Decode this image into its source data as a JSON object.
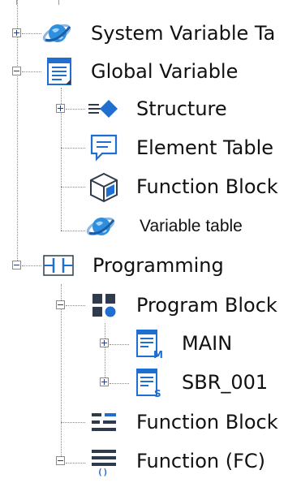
{
  "colors": {
    "line": "#8a8a8a",
    "icon_blue": "#1f6fd1",
    "icon_dark": "#2f3b4c",
    "globe_blue": "#2f8fdc",
    "text": "#111111"
  },
  "tree": {
    "system_variable_table": {
      "label": "System Variable Ta",
      "icon": "globe-icon",
      "expanded": false
    },
    "global_variable": {
      "label": "Global Variable",
      "icon": "document-icon",
      "expanded": true
    },
    "structure": {
      "label": "Structure",
      "icon": "structure-icon",
      "expanded": false
    },
    "element_table": {
      "label": "Element Table",
      "icon": "speech-bubble-icon"
    },
    "function_block_type": {
      "label": "Function Block",
      "icon": "cube-icon"
    },
    "variable_table": {
      "label": "Variable table",
      "icon": "globe-icon"
    },
    "programming": {
      "label": "Programming",
      "icon": "ladder-contact-icon",
      "expanded": true
    },
    "program_block": {
      "label": "Program Block",
      "icon": "grid-blocks-icon",
      "expanded": true
    },
    "main": {
      "label": "MAIN",
      "icon": "program-file-m-icon",
      "expanded": false
    },
    "sbr_001": {
      "label": "SBR_001",
      "icon": "program-file-s-icon",
      "expanded": false
    },
    "function_block": {
      "label": "Function Block",
      "icon": "function-block-icon"
    },
    "function_fc": {
      "label": "Function (FC)",
      "icon": "function-icon",
      "expanded": true
    }
  }
}
